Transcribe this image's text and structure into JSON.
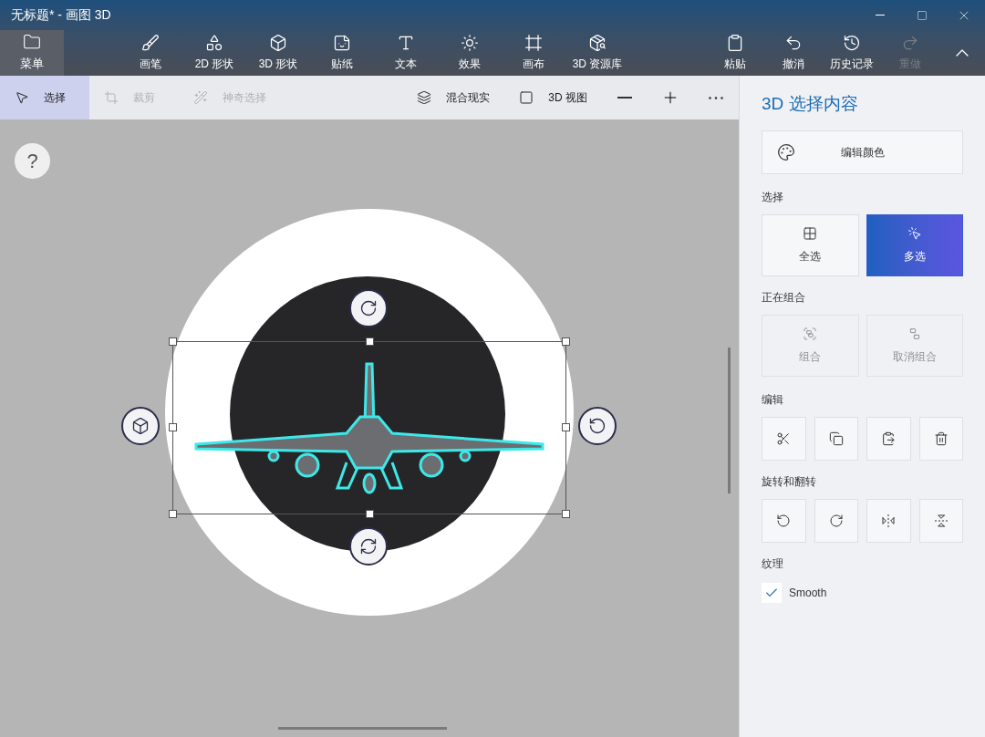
{
  "window": {
    "title": "无标题* - 画图 3D"
  },
  "toolbar": {
    "menu": {
      "label": "菜单",
      "selected": true
    },
    "tools": [
      {
        "kind": "brush",
        "label": "画笔"
      },
      {
        "kind": "shapes2d",
        "label": "2D 形状"
      },
      {
        "kind": "shapes3d",
        "label": "3D 形状"
      },
      {
        "kind": "sticker",
        "label": "贴纸"
      },
      {
        "kind": "text",
        "label": "文本"
      },
      {
        "kind": "effects",
        "label": "效果"
      },
      {
        "kind": "canvas",
        "label": "画布"
      },
      {
        "kind": "library",
        "label": "3D 资源库"
      }
    ],
    "actions": [
      {
        "kind": "paste",
        "label": "粘贴",
        "disabled": false
      },
      {
        "kind": "undo",
        "label": "撤消",
        "disabled": false
      },
      {
        "kind": "history",
        "label": "历史记录",
        "disabled": false
      },
      {
        "kind": "redo",
        "label": "重做",
        "disabled": true
      }
    ]
  },
  "subtoolbar": {
    "tools": [
      {
        "kind": "select",
        "label": "选择",
        "selected": true,
        "disabled": false
      },
      {
        "kind": "crop",
        "label": "裁剪",
        "selected": false,
        "disabled": true
      },
      {
        "kind": "magic",
        "label": "神奇选择",
        "selected": false,
        "disabled": true
      }
    ],
    "views": [
      {
        "kind": "mixed",
        "label": "混合现实"
      },
      {
        "kind": "view3d",
        "label": "3D 视图"
      }
    ]
  },
  "canvas": {
    "help": "?"
  },
  "panel": {
    "title": "3D 选择内容",
    "edit_color": "编辑颜色",
    "select": {
      "heading": "选择",
      "options": [
        {
          "kind": "all",
          "label": "全选",
          "selected": false
        },
        {
          "kind": "multi",
          "label": "多选",
          "selected": true
        }
      ]
    },
    "group": {
      "heading": "正在组合",
      "options": [
        {
          "kind": "group",
          "label": "组合",
          "disabled": true
        },
        {
          "kind": "ungroup",
          "label": "取消组合",
          "disabled": true
        }
      ]
    },
    "edit": {
      "heading": "编辑"
    },
    "rotate": {
      "heading": "旋转和翻转"
    },
    "texture": {
      "heading": "纹理",
      "option": {
        "label": "Smooth",
        "checked": true
      }
    }
  }
}
